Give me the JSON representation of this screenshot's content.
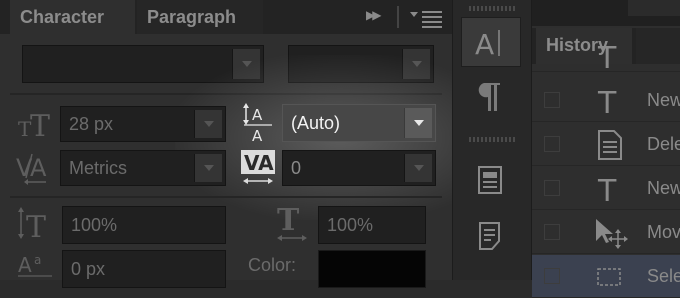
{
  "character_panel": {
    "tabs": [
      "Character",
      "Paragraph"
    ],
    "font_family": "",
    "font_style": "",
    "font_size": "28 px",
    "leading": "(Auto)",
    "kerning": "Metrics",
    "tracking": "0",
    "vertical_scale": "100%",
    "horizontal_scale": "100%",
    "baseline_shift": "0 px",
    "color_label": "Color:",
    "color_value": "#050505"
  },
  "history_panel": {
    "tab_label": "History",
    "items": [
      {
        "icon": "type-icon",
        "text": "New"
      },
      {
        "icon": "document-icon",
        "text": "Dele"
      },
      {
        "icon": "type-icon",
        "text": "New"
      },
      {
        "icon": "move-icon",
        "text": "Mov"
      },
      {
        "icon": "select-icon",
        "text": "Sele"
      }
    ]
  },
  "tool_strip": {
    "tools": [
      "character-panel-icon",
      "paragraph-icon",
      "document-icon",
      "notes-icon"
    ]
  }
}
